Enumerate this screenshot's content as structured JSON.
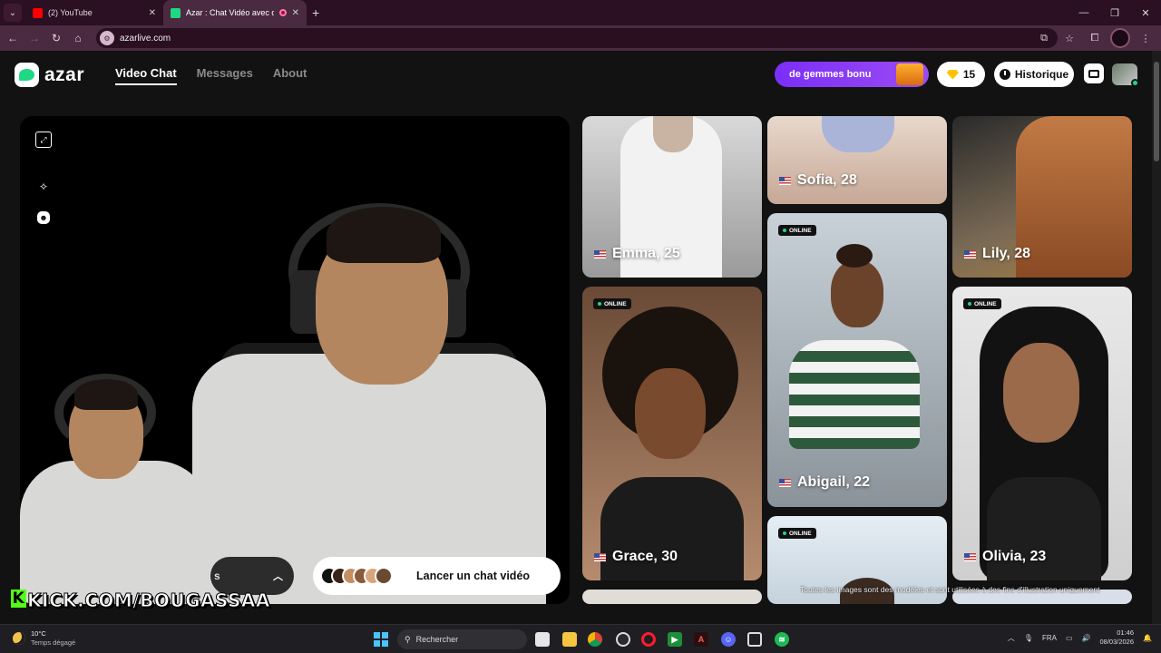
{
  "browser": {
    "tabs": [
      {
        "title": "(2) YouTube",
        "active": false,
        "favicon_color": "#ff0000"
      },
      {
        "title": "Azar : Chat Vidéo avec de n",
        "active": true,
        "favicon_color": "#1ed883"
      }
    ],
    "new_tab_icon": "plus-icon",
    "url": "azarlive.com"
  },
  "site": {
    "brand": "azar",
    "nav": [
      {
        "label": "Video Chat",
        "active": true
      },
      {
        "label": "Messages",
        "active": false
      },
      {
        "label": "About",
        "active": false
      }
    ],
    "promo_label": "de gemmes bonu",
    "gems_count": "15",
    "history_label": "Historique"
  },
  "video_panel": {
    "icons": [
      "expand-icon",
      "magic-wand-icon",
      "face-sticker-icon"
    ],
    "filter_label": "s",
    "launch_label": "Lancer un chat vidéo",
    "overlay_text": "KICK.COM/BOUGASSAA"
  },
  "profiles": [
    {
      "name": "Emma, 25",
      "online": false
    },
    {
      "name": "Sofia, 28",
      "online": false
    },
    {
      "name": "Lily, 28",
      "online": false
    },
    {
      "name": "Abigail, 22",
      "online": true
    },
    {
      "name": "Grace, 30",
      "online": true
    },
    {
      "name": "Olivia, 23",
      "online": true
    },
    {
      "name": "",
      "online": true
    }
  ],
  "online_label": "ONLINE",
  "disclaimer": "Toutes les images sont des modèles et sont utilisées à des fins d'illustration uniquement",
  "colors": {
    "accent": "#1ed883",
    "promo": "#7b2ff7",
    "background": "#121212"
  },
  "taskbar": {
    "temperature": "10°C",
    "weather": "Temps dégagé",
    "search_placeholder": "Rechercher",
    "language": "FRA",
    "time": "01:46",
    "date": "08/03/2026"
  }
}
